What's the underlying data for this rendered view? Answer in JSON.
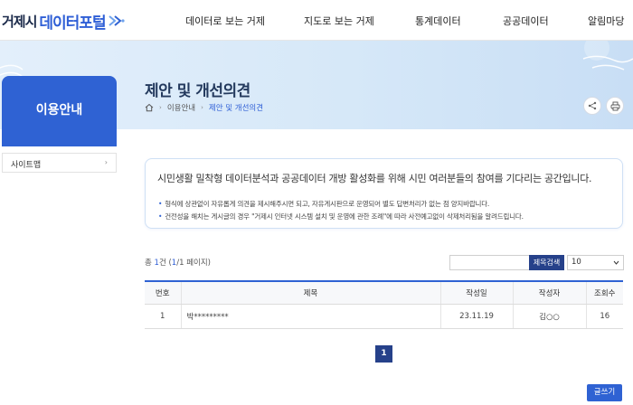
{
  "header": {
    "logo_text_a": "거제시",
    "logo_text_b": "데이터포털",
    "nav": [
      "데이터로 보는 거제",
      "지도로 보는 거제",
      "통계데이터",
      "공공데이터",
      "알림마당"
    ]
  },
  "banner": {
    "title": "제안 및 개선의견",
    "breadcrumb": [
      "이용안내",
      "제안 및 개선의견"
    ]
  },
  "sidebar": {
    "title": "이용안내",
    "items": [
      {
        "label": "사이트맵",
        "arrow": "›"
      }
    ]
  },
  "notice": {
    "main": "시민생활 밀착형 데이터분석과 공공데이터 개방 활성화를 위해 시민 여러분들의 참여를 기다리는 공간입니다.",
    "items": [
      "형식에 상관없이 자유롭게 의견을 제시해주시면 되고, 자유게시판으로 운영되어 별도 답변처리가 없는 점 양지바랍니다.",
      "건전성을 해치는 게시글의 경우 \"거제시 인터넷 시스템 설치 및 운영에 관한 조례\"에 따라 사전예고없이 삭제처리됨을 알려드립니다."
    ],
    "bullet": "•"
  },
  "toolbar": {
    "count_prefix": "총 ",
    "count_total": "1",
    "count_mid": "건 (",
    "count_page": "1",
    "count_suffix": "/1 페이지)",
    "search_placeholder": "",
    "search_button": "제목검색",
    "page_size": "10"
  },
  "table": {
    "headers": [
      "번호",
      "제목",
      "작성일",
      "작성자",
      "조회수"
    ],
    "rows": [
      {
        "no": "1",
        "title": "박*********",
        "date": "23.11.19",
        "author": "김○○",
        "views": "16"
      }
    ]
  },
  "pagination": {
    "current": "1"
  },
  "write_button": "글쓰기",
  "colors": {
    "primary": "#2f62d3",
    "navy": "#26418a",
    "title": "#23395d"
  }
}
